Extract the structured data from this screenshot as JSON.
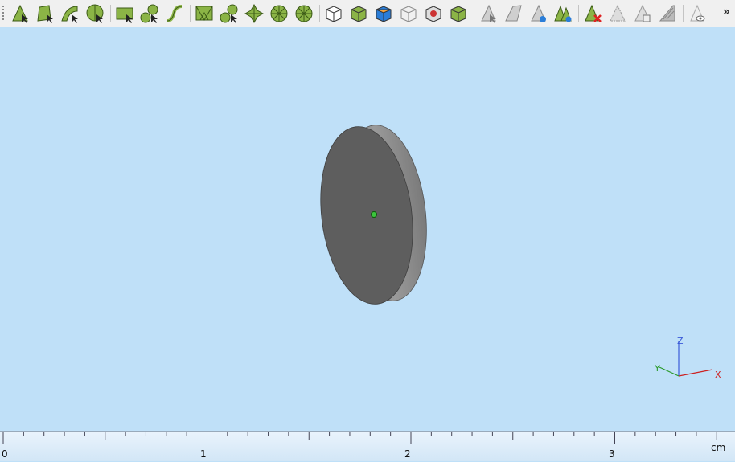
{
  "toolbar": {
    "groups": [
      {
        "name": "geometry-select",
        "icons": [
          "select-vertex-icon",
          "select-edge-icon",
          "select-face-icon",
          "select-cell-icon"
        ]
      },
      {
        "name": "domain-select",
        "icons": [
          "select-boundary-icon",
          "select-domain-icon",
          "select-curve-icon"
        ]
      },
      {
        "name": "mesh-select",
        "icons": [
          "select-mesh-face-icon",
          "select-mesh-domain-icon",
          "select-mesh-cluster-icon",
          "select-mesh-wheel-icon",
          "select-mesh-partial-icon"
        ]
      },
      {
        "name": "view",
        "icons": [
          "view-box-icon",
          "view-box-select-icon",
          "view-box-color-icon",
          "view-wireframe-icon",
          "view-box-highlight-icon",
          "view-box-solid-icon"
        ]
      },
      {
        "name": "build",
        "icons": [
          "build-icon",
          "build-arrow-icon",
          "build-selected-icon",
          "build-all-icon"
        ]
      },
      {
        "name": "delete",
        "icons": [
          "delete-build-icon",
          "disable-icon",
          "copy-build-icon",
          "hide-icon"
        ]
      },
      {
        "name": "visibility",
        "icons": [
          "show-hide-icon"
        ]
      }
    ],
    "overflow": "»"
  },
  "axes_triad": {
    "z": "Z",
    "x": "X",
    "y": "Y"
  },
  "ruler": {
    "labels": [
      "0",
      "1",
      "2",
      "3"
    ],
    "unit": "cm"
  },
  "colors": {
    "viewport": "#bfe0f8",
    "disk_face": "#5e5e5e",
    "disk_edge": "#8c8c8c",
    "icon_green": "#8bb446",
    "marker": "#3cc43c"
  }
}
